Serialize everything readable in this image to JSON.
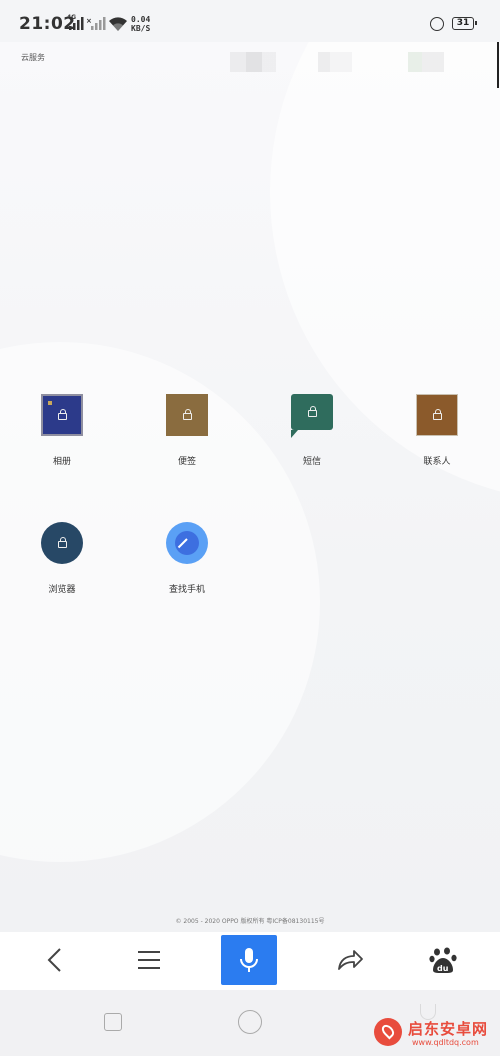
{
  "status_bar": {
    "time": "21:02",
    "network": "4G",
    "speed_value": "0.04",
    "speed_unit": "KB/S",
    "battery": "31",
    "icons": [
      "signal-icon",
      "signal-off-icon",
      "wifi-icon",
      "rotation-lock-icon",
      "battery-icon"
    ]
  },
  "page": {
    "site_label": "云服务",
    "copyright": "© 2005 - 2020 OPPO 版权所有 粤ICP备08130115号"
  },
  "apps": [
    {
      "label": "相册",
      "icon": "photos-icon"
    },
    {
      "label": "便签",
      "icon": "notes-icon"
    },
    {
      "label": "短信",
      "icon": "sms-icon"
    },
    {
      "label": "联系人",
      "icon": "contacts-icon"
    },
    {
      "label": "浏览器",
      "icon": "browser-icon"
    },
    {
      "label": "查找手机",
      "icon": "find-phone-icon"
    }
  ],
  "toolbar": {
    "icons": [
      "back-icon",
      "menu-icon",
      "microphone-icon",
      "share-icon",
      "baidu-icon"
    ],
    "accent": "#2b7cf0"
  },
  "nav_bar": {
    "icons": [
      "recent-apps-icon",
      "home-icon",
      "back-gesture-icon"
    ]
  },
  "watermark": {
    "name": "启东安卓网",
    "url": "www.qdltdq.com",
    "color": "#e84c3d"
  }
}
